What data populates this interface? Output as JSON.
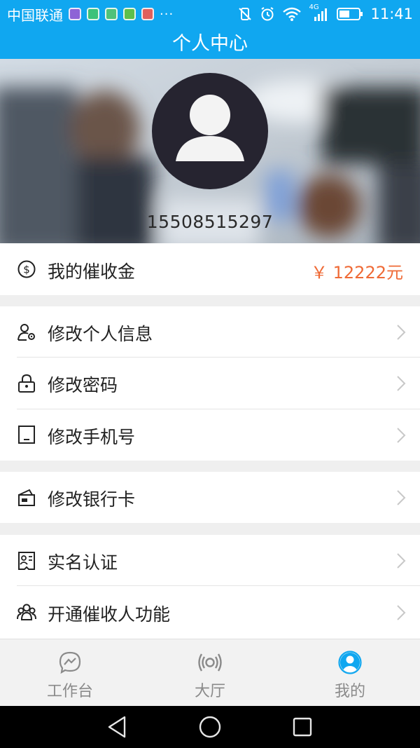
{
  "status_bar": {
    "carrier": "中国联通",
    "more": "···",
    "time": "11:41",
    "network": "4G",
    "app_icons": [
      "gallery-icon",
      "card-icon",
      "notes-icon",
      "app-icon",
      "blocked-app-icon"
    ]
  },
  "header": {
    "title": "个人中心"
  },
  "profile": {
    "phone": "15508515297"
  },
  "balance": {
    "label": "我的催收金",
    "value": "￥ 12222元"
  },
  "menu": {
    "edit_profile": "修改个人信息",
    "change_password": "修改密码",
    "change_phone": "修改手机号",
    "change_bank_card": "修改银行卡",
    "real_name_auth": "实名认证",
    "enable_collector": "开通催收人功能"
  },
  "tabs": {
    "workbench": "工作台",
    "hall": "大厅",
    "mine": "我的"
  },
  "colors": {
    "brand": "#10a7f0",
    "amount": "#ef6a36",
    "active_tab": "#10a7f0",
    "inactive_tab": "#8a8a8a"
  }
}
